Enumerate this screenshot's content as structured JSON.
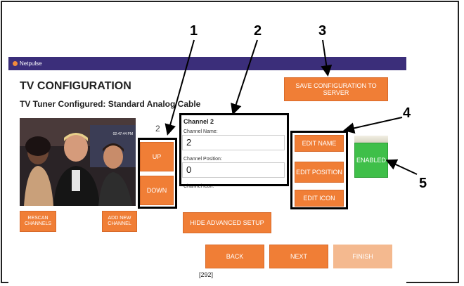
{
  "app": {
    "brand": "Netpulse"
  },
  "page": {
    "title": "TV CONFIGURATION",
    "subtitle": "TV Tuner Configured: Standard Analog Cable",
    "channel_number": "2",
    "footer_code": "[292]"
  },
  "video": {
    "timestamp": "02:47:44 PM"
  },
  "buttons": {
    "save": "SAVE CONFIGURATION TO SERVER",
    "up": "UP",
    "down": "DOWN",
    "edit_name": "EDIT NAME",
    "edit_position": "EDIT POSITION",
    "edit_icon": "EDIT ICON",
    "enabled": "ENABLED",
    "rescan": "RESCAN CHANNELS",
    "add_new": "ADD NEW CHANNEL",
    "hide_advanced": "HIDE ADVANCED SETUP",
    "back": "BACK",
    "next": "NEXT",
    "finish": "FINISH"
  },
  "channel_panel": {
    "heading": "Channel 2",
    "name_label": "Channel Name:",
    "name_value": "2",
    "position_label": "Channel Position:",
    "position_value": "0",
    "icon_label": "Channel Icon:"
  },
  "callouts": [
    "1",
    "2",
    "3",
    "4",
    "5"
  ],
  "colors": {
    "topbar": "#3b2e7a",
    "button": "#f07e36",
    "enabled": "#3fbf49"
  }
}
